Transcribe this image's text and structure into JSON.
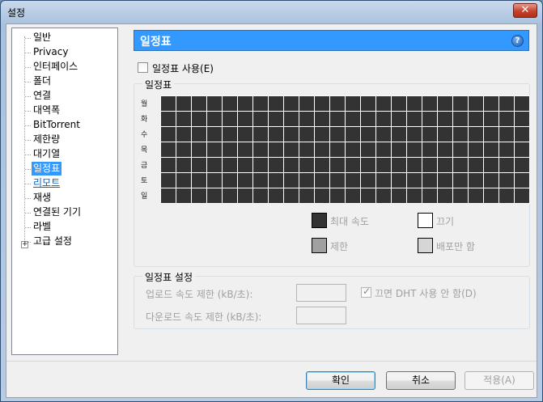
{
  "window": {
    "title": "설정",
    "close_label": "✕"
  },
  "tree": {
    "items": [
      {
        "label": "일반"
      },
      {
        "label": "Privacy"
      },
      {
        "label": "인터페이스"
      },
      {
        "label": "폴더"
      },
      {
        "label": "연결"
      },
      {
        "label": "대역폭"
      },
      {
        "label": "BitTorrent"
      },
      {
        "label": "제한량"
      },
      {
        "label": "대기열"
      },
      {
        "label": "일정표",
        "selected": true
      },
      {
        "label": "리모트",
        "link": true
      },
      {
        "label": "재생"
      },
      {
        "label": "연결된 기기"
      },
      {
        "label": "라벨"
      },
      {
        "label": "고급 설정",
        "expandable": true
      }
    ],
    "expander_glyph": "+"
  },
  "panel": {
    "title": "일정표",
    "help_glyph": "?",
    "enable_label": "일정표 사용(E)",
    "enable_checked": false,
    "schedule_group_title": "일정표",
    "days": [
      "월",
      "화",
      "수",
      "목",
      "금",
      "토",
      "일"
    ],
    "hours_per_day": 24,
    "legend": {
      "full_speed": "최대 속도",
      "off": "끄기",
      "limited": "제한",
      "seeding_only": "배포만 함"
    },
    "legend_colors": {
      "full_speed": "#333333",
      "off": "#ffffff",
      "limited": "#a0a0a0",
      "seeding_only": "#d6d6d6"
    },
    "settings_group_title": "일정표 설정",
    "upload_limit_label": "업로드 속도 제한 (kB/초):",
    "download_limit_label": "다운로드 속도 제한 (kB/초):",
    "upload_limit_value": "",
    "download_limit_value": "",
    "dht_label": "끄면 DHT 사용 안 함(D)",
    "dht_checked": true
  },
  "buttons": {
    "ok": "확인",
    "cancel": "취소",
    "apply": "적용(A)"
  }
}
